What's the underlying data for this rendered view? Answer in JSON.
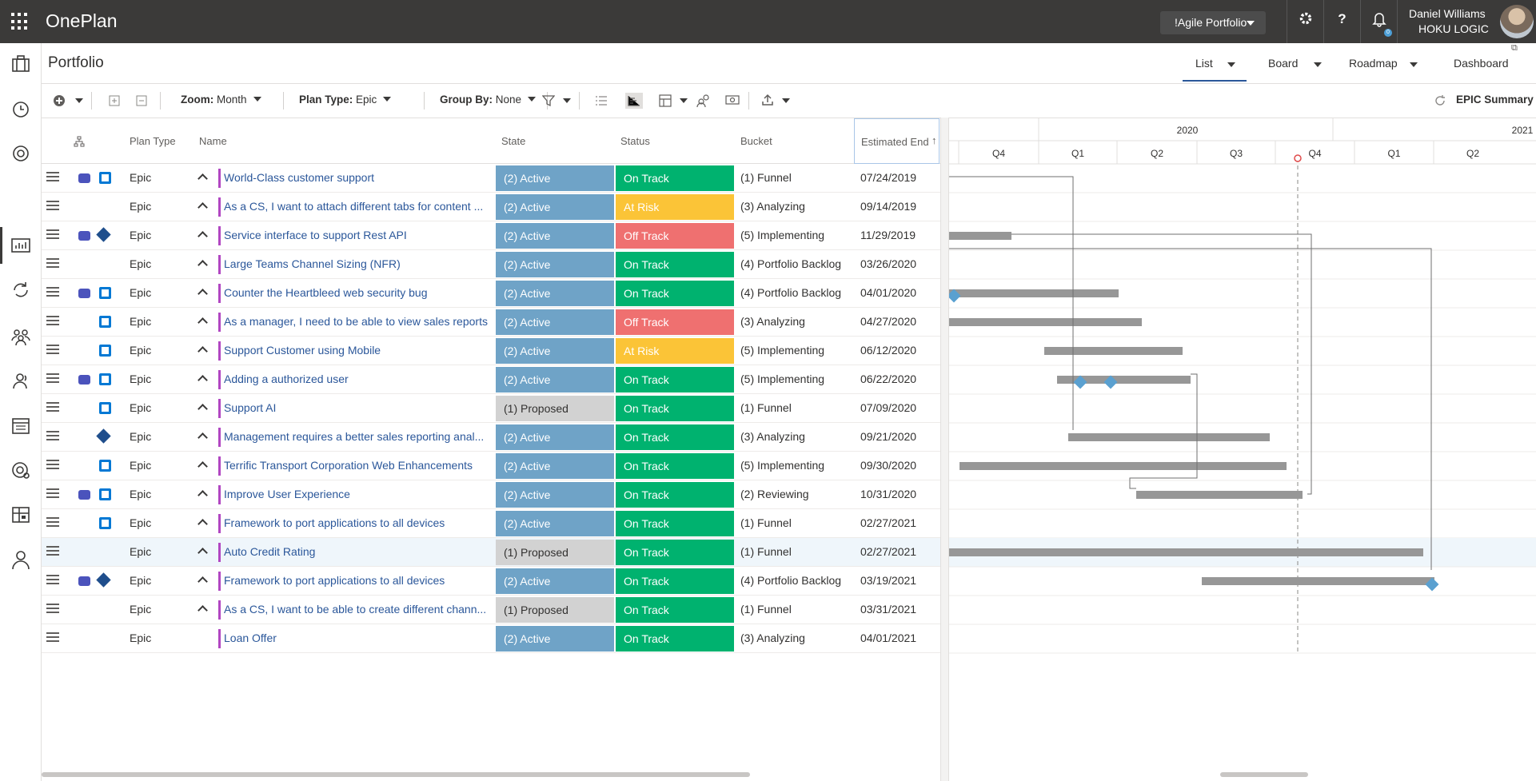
{
  "app": {
    "title": "OnePlan",
    "portfolio_selector": "!Agile Portfolio",
    "user_name": "Daniel Williams",
    "user_org": "HOKU LOGIC",
    "notification_count": "0"
  },
  "page": {
    "title": "Portfolio",
    "views": [
      "List",
      "Board",
      "Roadmap",
      "Dashboard"
    ],
    "active_view": "List"
  },
  "toolbar": {
    "zoom_label": "Zoom:",
    "zoom_value": "Month",
    "plan_type_label": "Plan Type:",
    "plan_type_value": "Epic",
    "group_by_label": "Group By:",
    "group_by_value": "None",
    "summary_label": "EPIC Summary"
  },
  "grid": {
    "headers": {
      "plan_type": "Plan Type",
      "name": "Name",
      "state": "State",
      "status": "Status",
      "bucket": "Bucket",
      "estimated_end": "Estimated End"
    },
    "rows": [
      {
        "icons": "teams-azdo",
        "plan_type": "Epic",
        "name": "World-Class customer support",
        "state": "(2) Active",
        "status": "On Track",
        "bucket": "(1) Funnel",
        "end": "07/24/2019",
        "chev": true
      },
      {
        "icons": "",
        "plan_type": "Epic",
        "name": "As a CS, I want to attach different tabs for content ...",
        "state": "(2) Active",
        "status": "At Risk",
        "bucket": "(3) Analyzing",
        "end": "09/14/2019",
        "chev": true
      },
      {
        "icons": "teams-jira",
        "plan_type": "Epic",
        "name": "Service interface to support Rest API",
        "state": "(2) Active",
        "status": "Off Track",
        "bucket": "(5) Implementing",
        "end": "11/29/2019",
        "chev": true
      },
      {
        "icons": "",
        "plan_type": "Epic",
        "name": "Large Teams Channel Sizing (NFR)",
        "state": "(2) Active",
        "status": "On Track",
        "bucket": "(4) Portfolio Backlog",
        "end": "03/26/2020",
        "chev": true
      },
      {
        "icons": "teams-azdo",
        "plan_type": "Epic",
        "name": "Counter the Heartbleed web security bug",
        "state": "(2) Active",
        "status": "On Track",
        "bucket": "(4) Portfolio Backlog",
        "end": "04/01/2020",
        "chev": true
      },
      {
        "icons": "azdo",
        "plan_type": "Epic",
        "name": "As a manager, I need to be able to view sales reports",
        "state": "(2) Active",
        "status": "Off Track",
        "bucket": "(3) Analyzing",
        "end": "04/27/2020",
        "chev": true
      },
      {
        "icons": "azdo",
        "plan_type": "Epic",
        "name": "Support Customer using Mobile",
        "state": "(2) Active",
        "status": "At Risk",
        "bucket": "(5) Implementing",
        "end": "06/12/2020",
        "chev": true
      },
      {
        "icons": "teams-azdo",
        "plan_type": "Epic",
        "name": "Adding a authorized user",
        "state": "(2) Active",
        "status": "On Track",
        "bucket": "(5) Implementing",
        "end": "06/22/2020",
        "chev": true
      },
      {
        "icons": "azdo",
        "plan_type": "Epic",
        "name": "Support AI",
        "state": "(1) Proposed",
        "status": "On Track",
        "bucket": "(1) Funnel",
        "end": "07/09/2020",
        "chev": true
      },
      {
        "icons": "jira",
        "plan_type": "Epic",
        "name": "Management requires a better sales reporting anal...",
        "state": "(2) Active",
        "status": "On Track",
        "bucket": "(3) Analyzing",
        "end": "09/21/2020",
        "chev": true
      },
      {
        "icons": "azdo",
        "plan_type": "Epic",
        "name": "Terrific Transport Corporation Web Enhancements",
        "state": "(2) Active",
        "status": "On Track",
        "bucket": "(5) Implementing",
        "end": "09/30/2020",
        "chev": true
      },
      {
        "icons": "teams-azdo",
        "plan_type": "Epic",
        "name": "Improve User Experience",
        "state": "(2) Active",
        "status": "On Track",
        "bucket": "(2) Reviewing",
        "end": "10/31/2020",
        "chev": true
      },
      {
        "icons": "azdo",
        "plan_type": "Epic",
        "name": "Framework to port applications to all devices",
        "state": "(2) Active",
        "status": "On Track",
        "bucket": "(1) Funnel",
        "end": "02/27/2021",
        "chev": true
      },
      {
        "icons": "",
        "plan_type": "Epic",
        "name": "Auto Credit Rating",
        "state": "(1) Proposed",
        "status": "On Track",
        "bucket": "(1) Funnel",
        "end": "02/27/2021",
        "chev": true,
        "highlight": true
      },
      {
        "icons": "teams-jira",
        "plan_type": "Epic",
        "name": "Framework to port applications to all devices",
        "state": "(2) Active",
        "status": "On Track",
        "bucket": "(4) Portfolio Backlog",
        "end": "03/19/2021",
        "chev": true
      },
      {
        "icons": "",
        "plan_type": "Epic",
        "name": "As a CS, I want to be able to create different chann...",
        "state": "(1) Proposed",
        "status": "On Track",
        "bucket": "(1) Funnel",
        "end": "03/31/2021",
        "chev": true
      },
      {
        "icons": "",
        "plan_type": "Epic",
        "name": "Loan Offer",
        "state": "(2) Active",
        "status": "On Track",
        "bucket": "(3) Analyzing",
        "end": "04/01/2021",
        "chev": false
      }
    ]
  },
  "gantt": {
    "years": [
      "2020",
      "2021"
    ],
    "quarters": [
      "Q4",
      "Q1",
      "Q2",
      "Q3",
      "Q4",
      "Q1",
      "Q2"
    ]
  }
}
